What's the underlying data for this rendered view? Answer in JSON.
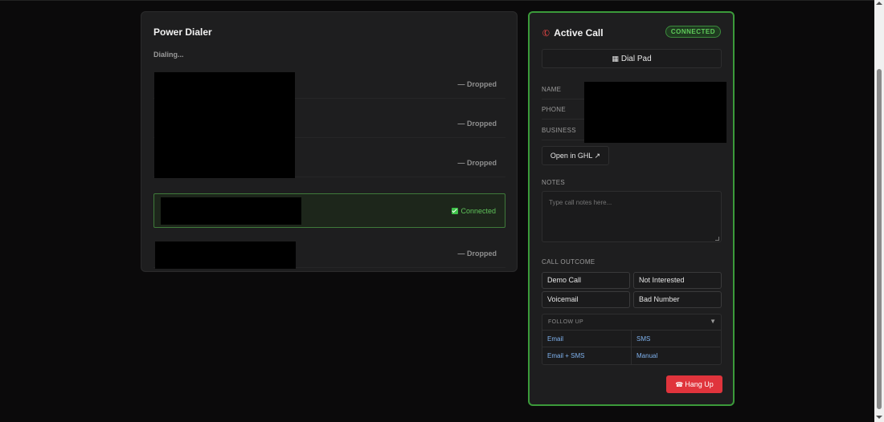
{
  "dialer": {
    "title": "Power Dialer",
    "status": "Dialing...",
    "lines": [
      {
        "status": "— Dropped"
      },
      {
        "status": "— Dropped"
      },
      {
        "status": "— Dropped"
      },
      {
        "status": "Connected"
      },
      {
        "status": "— Dropped"
      }
    ]
  },
  "call": {
    "title": "Active Call",
    "badge": "CONNECTED",
    "dial_pad_label": "Dial Pad",
    "fields": {
      "name": "NAME",
      "phone": "PHONE",
      "business": "BUSINESS"
    },
    "open_ghl_label": "Open in GHL ↗",
    "notes_label": "NOTES",
    "notes_placeholder": "Type call notes here...",
    "outcome_label": "CALL OUTCOME",
    "outcomes": [
      "Demo Call",
      "Not Interested",
      "Voicemail",
      "Bad Number"
    ],
    "follow_up": {
      "label": "FOLLOW UP",
      "options": [
        "Email",
        "SMS",
        "Email + SMS",
        "Manual"
      ]
    },
    "hang_up_label": "Hang Up"
  },
  "colors": {
    "accent_green": "#3b9a3a",
    "danger": "#e0343c",
    "link_blue": "#7fb2ee"
  }
}
